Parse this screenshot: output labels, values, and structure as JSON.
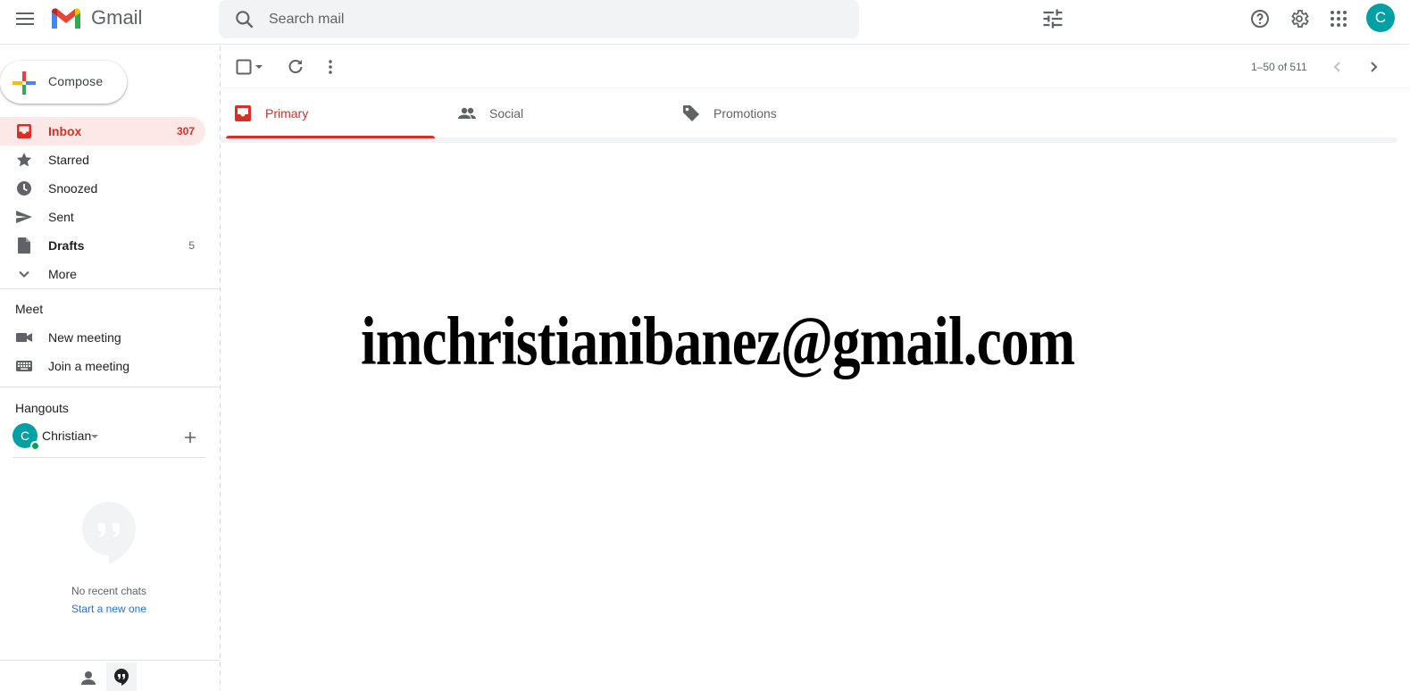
{
  "header": {
    "app_name": "Gmail",
    "search_placeholder": "Search mail",
    "account_initial": "C"
  },
  "compose": {
    "label": "Compose"
  },
  "sidebar": {
    "items": [
      {
        "label": "Inbox",
        "count": "307",
        "icon": "inbox-icon",
        "active": true
      },
      {
        "label": "Starred",
        "count": "",
        "icon": "star-icon"
      },
      {
        "label": "Snoozed",
        "count": "",
        "icon": "clock-icon"
      },
      {
        "label": "Sent",
        "count": "",
        "icon": "send-icon"
      },
      {
        "label": "Drafts",
        "count": "5",
        "icon": "draft-icon"
      },
      {
        "label": "More",
        "count": "",
        "icon": "chevron-down-icon"
      }
    ],
    "meet": {
      "title": "Meet",
      "items": [
        {
          "label": "New meeting",
          "icon": "video-camera-icon"
        },
        {
          "label": "Join a meeting",
          "icon": "keyboard-icon"
        }
      ]
    },
    "hangouts": {
      "title": "Hangouts",
      "user_initial": "C",
      "user_name": "Christian",
      "no_chats": "No recent chats",
      "start_new": "Start a new one"
    }
  },
  "toolbar": {
    "pager": "1–50 of 511"
  },
  "tabs": [
    {
      "label": "Primary",
      "icon": "inbox-icon",
      "active": true
    },
    {
      "label": "Social",
      "icon": "people-icon"
    },
    {
      "label": "Promotions",
      "icon": "tag-icon"
    }
  ],
  "content": {
    "overlay_text": "imchristianibanez@gmail.com"
  },
  "colors": {
    "accent_red": "#d93025",
    "avatar_teal": "#00a0a4",
    "active_bg": "#fce8e6"
  }
}
